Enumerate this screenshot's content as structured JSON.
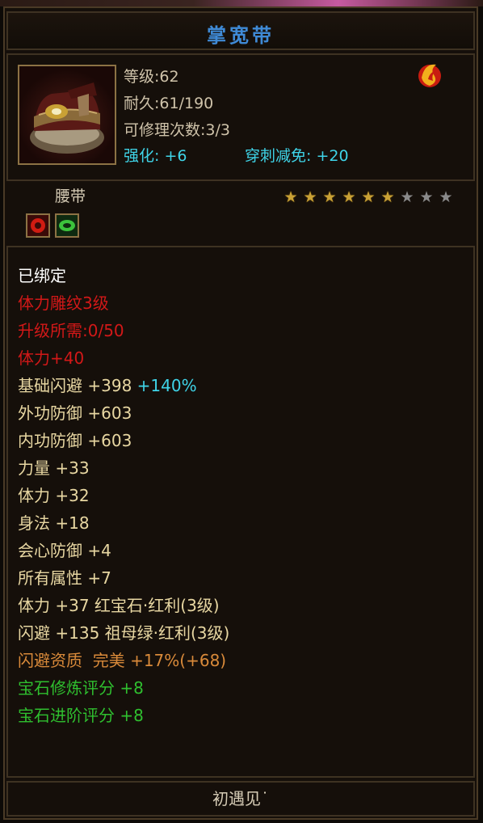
{
  "item": {
    "name": "掌宽带",
    "type": "腰带",
    "stats": {
      "level_label": "等级",
      "level_value": ":62",
      "durability_label": "耐久",
      "durability_value": ":61/190",
      "repair_label": "可修理次数",
      "repair_value": ":3/3",
      "enhance_label": "强化:",
      "enhance_value": "+6",
      "pierce_label": "穿刺减免:",
      "pierce_value": "+20"
    },
    "stars": {
      "filled": 6,
      "total": 9
    },
    "colors": {
      "title": "#3f8ad6",
      "cyan": "#3fd4e8",
      "red": "#d21818",
      "yellow": "#e8d7a2",
      "orange": "#d98a3a",
      "green": "#2fbf2f"
    }
  },
  "attributes": [
    {
      "text": "已绑定",
      "color": "white"
    },
    {
      "text": "体力雕纹3级",
      "color": "red"
    },
    {
      "text": "升级所需:0/50",
      "color": "red"
    },
    {
      "text": "体力+40",
      "color": "red"
    },
    {
      "text": "基础闪避 +398",
      "extra": "+140%",
      "color": "yellow"
    },
    {
      "text": "外功防御 +603",
      "color": "yellow"
    },
    {
      "text": "内功防御 +603",
      "color": "yellow"
    },
    {
      "text": "力量 +33",
      "color": "yellow"
    },
    {
      "text": "体力 +32",
      "color": "yellow"
    },
    {
      "text": "身法 +18",
      "color": "yellow"
    },
    {
      "text": "会心防御 +4",
      "color": "yellow"
    },
    {
      "text": "所有属性 +7",
      "color": "yellow"
    },
    {
      "text": "体力 +37 红宝石·红利(3级)",
      "color": "yellow"
    },
    {
      "text": "闪避 +135 祖母绿·红利(3级)",
      "color": "yellow"
    },
    {
      "text": "闪避资质  完美 +17%(+68)",
      "color": "orange"
    },
    {
      "text": "宝石修炼评分 +8",
      "color": "green"
    },
    {
      "text": "宝石进阶评分 +8",
      "color": "green"
    }
  ],
  "footer": {
    "text": "初遇见˙"
  }
}
